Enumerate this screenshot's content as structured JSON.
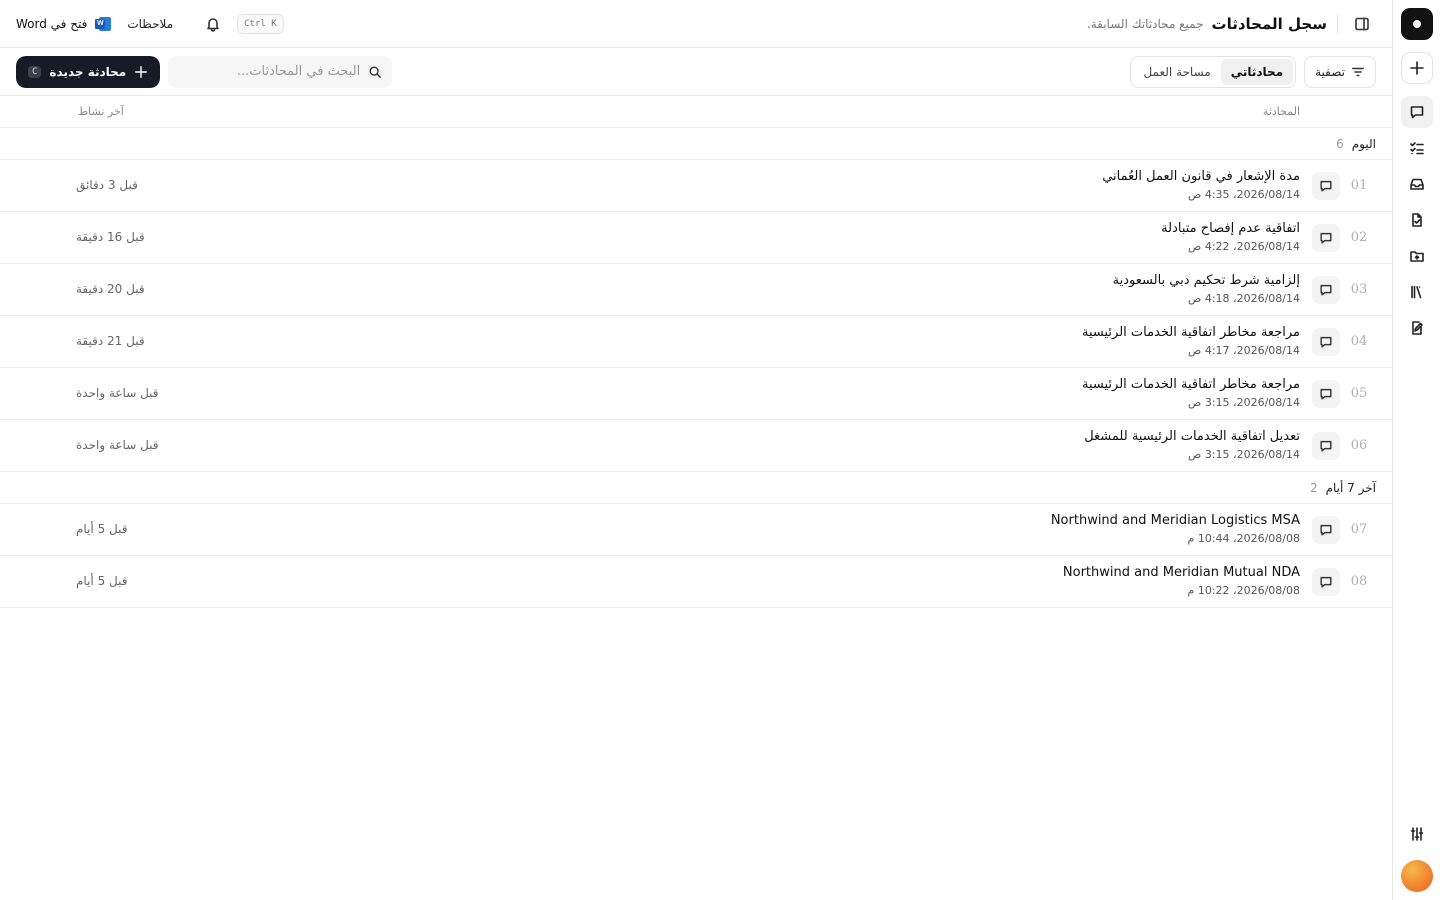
{
  "header": {
    "title": "سجل المحادثات",
    "subtitle": "جميع محادثاتك السابقة.",
    "shortcut": "Ctrl K",
    "notes_label": "ملاحظات",
    "word_label": "فتح في Word",
    "word_icon_letter": "W"
  },
  "toolbar": {
    "filter_label": "تصفية",
    "tabs": [
      {
        "label": "محادثاتي",
        "active": true
      },
      {
        "label": "مساحة العمل",
        "active": false
      }
    ],
    "search_placeholder": "البحث في المحادثات...",
    "new_label": "محادثة جديدة",
    "new_key": "C"
  },
  "columns": {
    "conversation": "المحادثة",
    "last_activity": "آخر نشاط"
  },
  "groups": [
    {
      "label": "اليوم",
      "count": "6",
      "rows": [
        {
          "num": "01",
          "title": "مدة الإشعار في قانون العمل العُماني",
          "date": "2026/08/14، 4:35 ص",
          "ago": "قبل 3 دقائق"
        },
        {
          "num": "02",
          "title": "اتفاقية عدم إفصاح متبادلة",
          "date": "2026/08/14، 4:22 ص",
          "ago": "قبل 16 دقيقة"
        },
        {
          "num": "03",
          "title": "إلزامية شرط تحكيم دبي بالسعودية",
          "date": "2026/08/14، 4:18 ص",
          "ago": "قبل 20 دقيقة"
        },
        {
          "num": "04",
          "title": "مراجعة مخاطر اتفاقية الخدمات الرئيسية",
          "date": "2026/08/14، 4:17 ص",
          "ago": "قبل 21 دقيقة"
        },
        {
          "num": "05",
          "title": "مراجعة مخاطر اتفاقية الخدمات الرئيسية",
          "date": "2026/08/14، 3:15 ص",
          "ago": "قبل ساعة واحدة"
        },
        {
          "num": "06",
          "title": "تعديل اتفاقية الخدمات الرئيسية للمشغل",
          "date": "2026/08/14، 3:15 ص",
          "ago": "قبل ساعة واحدة"
        }
      ]
    },
    {
      "label": "آخر 7 أيام",
      "count": "2",
      "rows": [
        {
          "num": "07",
          "title": "Northwind and Meridian Logistics MSA",
          "date": "2026/08/08، 10:44 م",
          "ago": "قبل 5 أيام"
        },
        {
          "num": "08",
          "title": "Northwind and Meridian Mutual NDA",
          "date": "2026/08/08، 10:22 م",
          "ago": "قبل 5 أيام"
        }
      ]
    }
  ],
  "rail": {
    "icons": [
      "app-logo-icon",
      "plus-icon",
      "chat-icon",
      "checklist-icon",
      "inbox-icon",
      "document-icon",
      "folder-icon",
      "library-icon",
      "edit-document-icon",
      "sliders-icon",
      "avatar"
    ]
  }
}
